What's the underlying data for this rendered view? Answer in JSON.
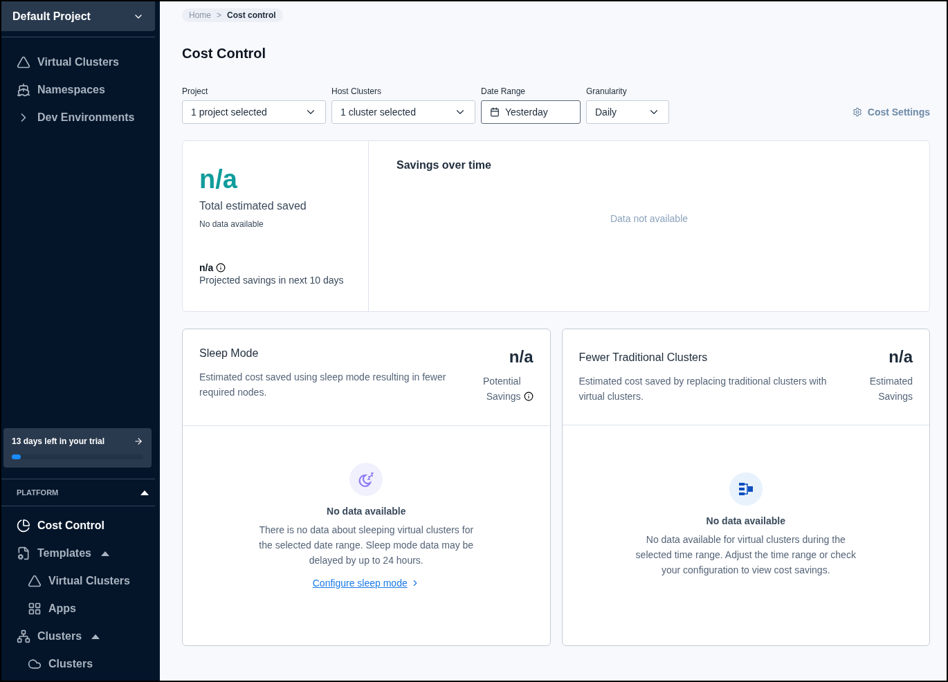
{
  "sidebar": {
    "project": "Default Project",
    "top_items": [
      {
        "label": "Virtual Clusters"
      },
      {
        "label": "Namespaces"
      },
      {
        "label": "Dev Environments"
      }
    ],
    "trial": {
      "text": "13 days left in your trial",
      "level": 0.07
    },
    "section": {
      "label": "PLATFORM",
      "expanded": true
    },
    "items": [
      {
        "label": "Cost Control",
        "selected": true
      },
      {
        "label": "Templates",
        "selected": false,
        "expanded": true,
        "children": [
          {
            "label": "Virtual Clusters",
            "selected": false
          },
          {
            "label": "Apps",
            "selected": false
          }
        ]
      },
      {
        "label": "Clusters",
        "selected": false,
        "expanded": true,
        "children": [
          {
            "label": "Clusters",
            "selected": false
          }
        ]
      }
    ]
  },
  "breadcrumb": {
    "items": [
      "Home",
      "Cost control"
    ],
    "separator": ">"
  },
  "title": "Cost Control",
  "filters": [
    {
      "label": "Project",
      "value": "1 project selected",
      "kind": "select"
    },
    {
      "label": "Host Clusters",
      "value": "1 cluster selected",
      "kind": "select"
    },
    {
      "label": "Date Range",
      "value": "Yesterday",
      "kind": "date"
    },
    {
      "label": "Granularity",
      "value": "Daily",
      "kind": "select"
    }
  ],
  "settings_link": "Cost Settings",
  "summary": {
    "value": "n/a",
    "label": "Total estimated saved",
    "note": "No data available",
    "projected_value": "n/a",
    "projected_label": "Projected savings in next 10 days"
  },
  "savings_chart": {
    "title": "Savings over time",
    "empty": "Data not available"
  },
  "cards": [
    {
      "title": "Sleep Mode",
      "value": "n/a",
      "description": "Estimated cost saved using sleep mode resulting in fewer required nodes.",
      "value_label": "Potential Savings",
      "info": true,
      "empty_title": "No data available",
      "empty_text": "There is no data about sleeping virtual clusters for the selected date range. Sleep mode data may be delayed by up to 24 hours.",
      "link": "Configure sleep mode"
    },
    {
      "title": "Fewer Traditional Clusters",
      "value": "n/a",
      "description": "Estimated cost saved by replacing traditional clusters with virtual clusters.",
      "value_label": "Estimated Savings",
      "info": false,
      "empty_title": "No data available",
      "empty_text": "No data available for virtual clusters during the selected time range. Adjust the time range or check your configuration to view cost savings."
    }
  ]
}
